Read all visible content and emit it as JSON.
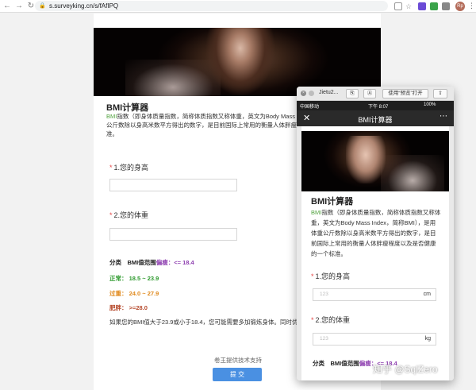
{
  "browser": {
    "url": "s.surveyking.cn/s/fAfIPQ",
    "avatar_initials": "Rp"
  },
  "survey": {
    "title": "BMI计算器",
    "intro_highlight": "BMI",
    "intro_rest_line1": "指数（即身体质量指数，简称体质指数又称体重，英文为Body Mass Index",
    "intro_line2": "公斤数除以身高米数平方得出的数字，是目前国际上常用的衡量人体胖瘦程度",
    "intro_line3": "准。",
    "q1": {
      "star": "*",
      "label": "1.您的身高"
    },
    "q2": {
      "star": "*",
      "label": "2.您的体重"
    },
    "ranges": {
      "header_prefix": "分类　BMI值范围",
      "thin_label": "偏瘦：<= 18.4",
      "normal": "正常：  18.5 ~ 23.9",
      "over": "过重：  24.0 ~ 27.9",
      "fat": "肥胖：  >=28.0"
    },
    "tip": "如果您的BMI值大于23.9或小于18.4，您可能需要多加锻炼身体。同时优化",
    "support": "卷王提供技术支持",
    "submit": "提 交"
  },
  "preview": {
    "window_title": "Jietu2...",
    "open_button": "使用“预览”打开",
    "status": {
      "carrier": "中国移动",
      "time": "下午 8:07",
      "battery": "100%"
    },
    "nav_title": "BMI计算器",
    "title": "BMI计算器",
    "intro_highlight": "BMI",
    "intro_rest": "指数（即身体质量指数，简称体质指数又称体重，英文为Body Mass Index，简称BMI），是用体重公斤数除以身高米数平方得出的数字，是目前国际上常用的衡量人体胖瘦程度以及是否健康的一个标准。",
    "q1": {
      "star": "*",
      "label": "1.您的身高",
      "placeholder": "123",
      "unit": "cm"
    },
    "q2": {
      "star": "*",
      "label": "2.您的体重",
      "placeholder": "123",
      "unit": "kg"
    },
    "range_prefix": "分类　BMI值范围",
    "range_thin": "偏瘦：<= 18.4"
  },
  "watermark": "知乎 @SqlZero",
  "colors": {
    "normal": "#2e9a2e",
    "over": "#e08a1e",
    "fat": "#b5482a",
    "thin": "#8e3fb0",
    "submit": "#4a90e2",
    "highlight": "#52a33f"
  }
}
